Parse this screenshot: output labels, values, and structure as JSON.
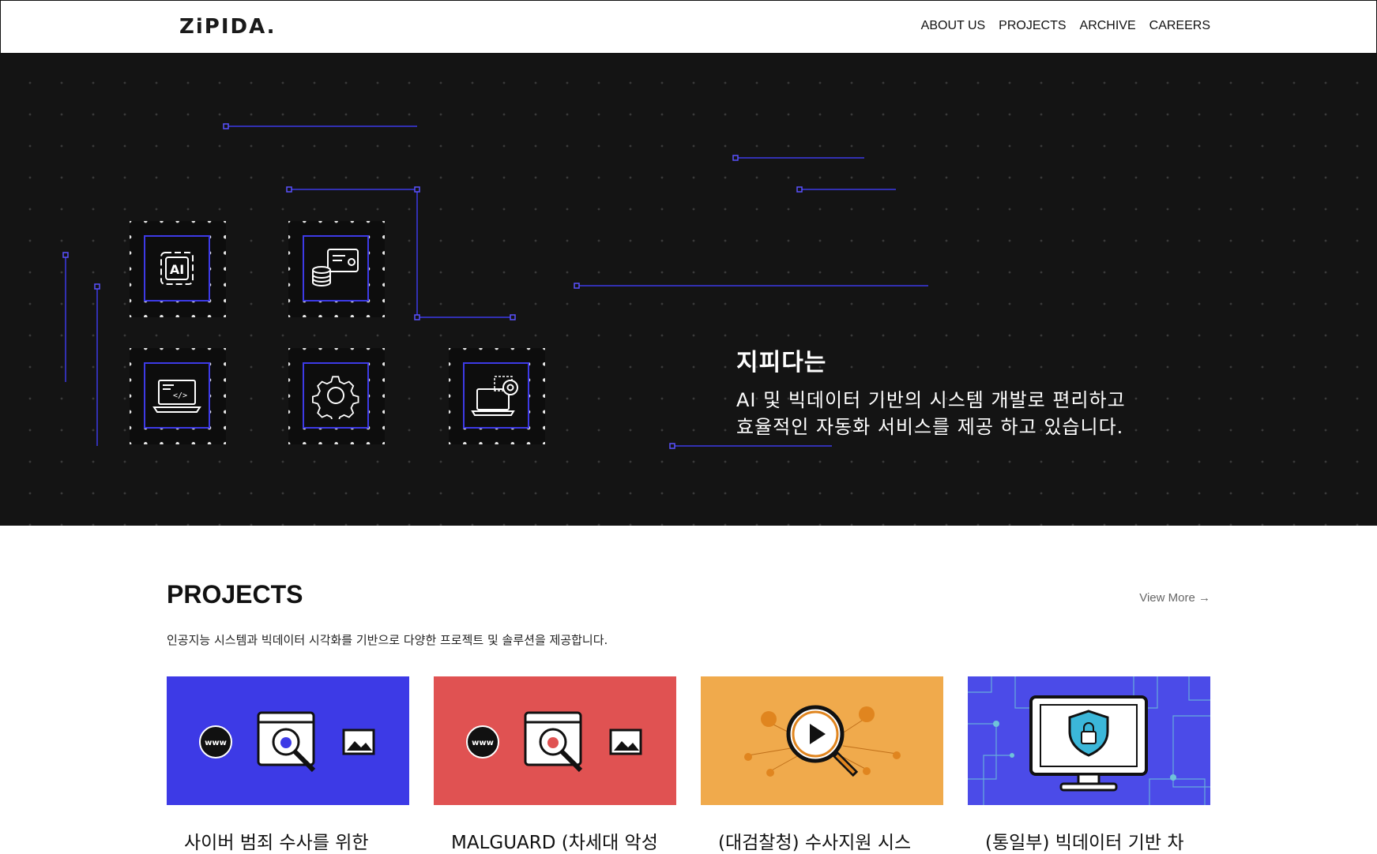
{
  "header": {
    "logo": "ZiPIDA.",
    "nav": [
      "ABOUT US",
      "PROJECTS",
      "ARCHIVE",
      "CAREERS"
    ]
  },
  "hero": {
    "title": "지피다는",
    "description": "AI 및 빅데이터 기반의 시스템 개발로 편리하고\n효율적인 자동화 서비스를 제공 하고 있습니다.",
    "tiles": [
      {
        "icon": "ai-chip-icon",
        "label": "AI"
      },
      {
        "icon": "database-card-icon"
      },
      {
        "icon": "laptop-code-icon"
      },
      {
        "icon": "gear-icon"
      },
      {
        "icon": "laptop-settings-icon"
      }
    ],
    "accent_color": "#3d3ae6"
  },
  "projects": {
    "title": "PROJECTS",
    "view_more": "View More →",
    "description": "인공지능 시스템과 빅데이터 시각화를 기반으로 다양한 프로젝트 및 솔루션을 제공합니다.",
    "cards": [
      {
        "title": "사이버 범죄 수사를 위한",
        "bg": "#3d3ae6",
        "icon": "web-search-malware-icon"
      },
      {
        "title": "MALGUARD (차세대 악성",
        "bg": "#e05252",
        "icon": "web-search-malware-icon"
      },
      {
        "title": "(대검찰청) 수사지원 시스",
        "bg": "#f0aa4c",
        "icon": "video-search-icon"
      },
      {
        "title": "(통일부) 빅데이터 기반 차",
        "bg": "#4b4be8",
        "icon": "monitor-lock-icon"
      }
    ]
  }
}
